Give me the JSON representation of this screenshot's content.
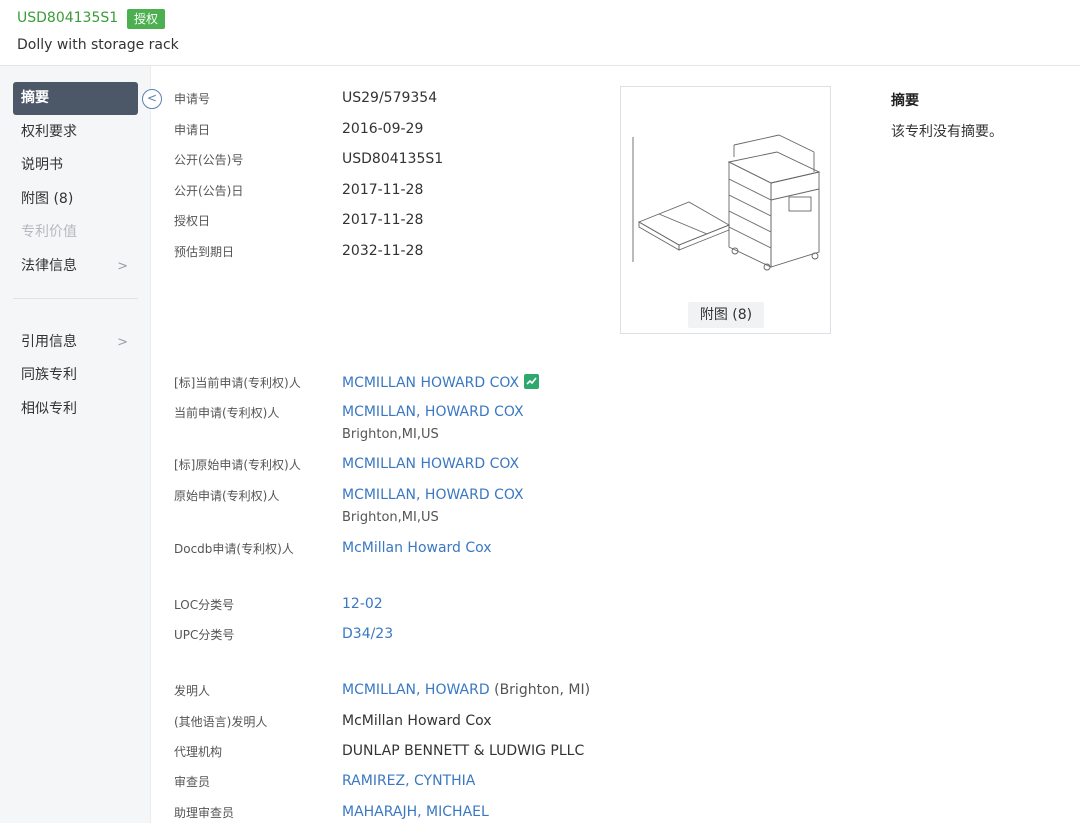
{
  "header": {
    "publication_number": "USD804135S1",
    "status_badge": "授权",
    "title": "Dolly with storage rack"
  },
  "sidebar": {
    "items": [
      {
        "label": "摘要"
      },
      {
        "label": "权利要求"
      },
      {
        "label": "说明书"
      },
      {
        "label": "附图 (8)"
      },
      {
        "label": "专利价值"
      },
      {
        "label": "法律信息"
      },
      {
        "label": "引用信息"
      },
      {
        "label": "同族专利"
      },
      {
        "label": "相似专利"
      }
    ]
  },
  "basic_info": [
    {
      "label": "申请号",
      "value": "US29/579354"
    },
    {
      "label": "申请日",
      "value": "2016-09-29"
    },
    {
      "label": "公开(公告)号",
      "value": "USD804135S1"
    },
    {
      "label": "公开(公告)日",
      "value": "2017-11-28"
    },
    {
      "label": "授权日",
      "value": "2017-11-28"
    },
    {
      "label": "预估到期日",
      "value": "2032-11-28"
    }
  ],
  "figure": {
    "button_label": "附图 (8)"
  },
  "abstract": {
    "heading": "摘要",
    "text": "该专利没有摘要。"
  },
  "applicants": [
    {
      "label": "[标]当前申请(专利权)人",
      "value": "MCMILLAN HOWARD COX"
    },
    {
      "label": "当前申请(专利权)人",
      "value": "MCMILLAN, HOWARD COX",
      "sub": "Brighton,MI,US"
    },
    {
      "label": "[标]原始申请(专利权)人",
      "value": "MCMILLAN HOWARD COX"
    },
    {
      "label": "原始申请(专利权)人",
      "value": "MCMILLAN, HOWARD COX",
      "sub": "Brighton,MI,US"
    },
    {
      "label": "Docdb申请(专利权)人",
      "value": "McMillan Howard Cox"
    }
  ],
  "classification": [
    {
      "label": "LOC分类号",
      "value": "12-02"
    },
    {
      "label": "UPC分类号",
      "value": "D34/23"
    }
  ],
  "people": [
    {
      "label": "发明人",
      "value": "MCMILLAN, HOWARD",
      "suffix": "(Brighton, MI)"
    },
    {
      "label": "(其他语言)发明人",
      "value": "McMillan Howard Cox"
    },
    {
      "label": "代理机构",
      "value": "DUNLAP BENNETT & LUDWIG PLLC"
    },
    {
      "label": "审查员",
      "value": "RAMIREZ, CYNTHIA"
    },
    {
      "label": "助理审查员",
      "value": "MAHARAJH, MICHAEL"
    }
  ],
  "colors": {
    "accent_green": "#3a9c3a",
    "link_blue": "#3a78c2",
    "nav_active": "#4c5868"
  }
}
